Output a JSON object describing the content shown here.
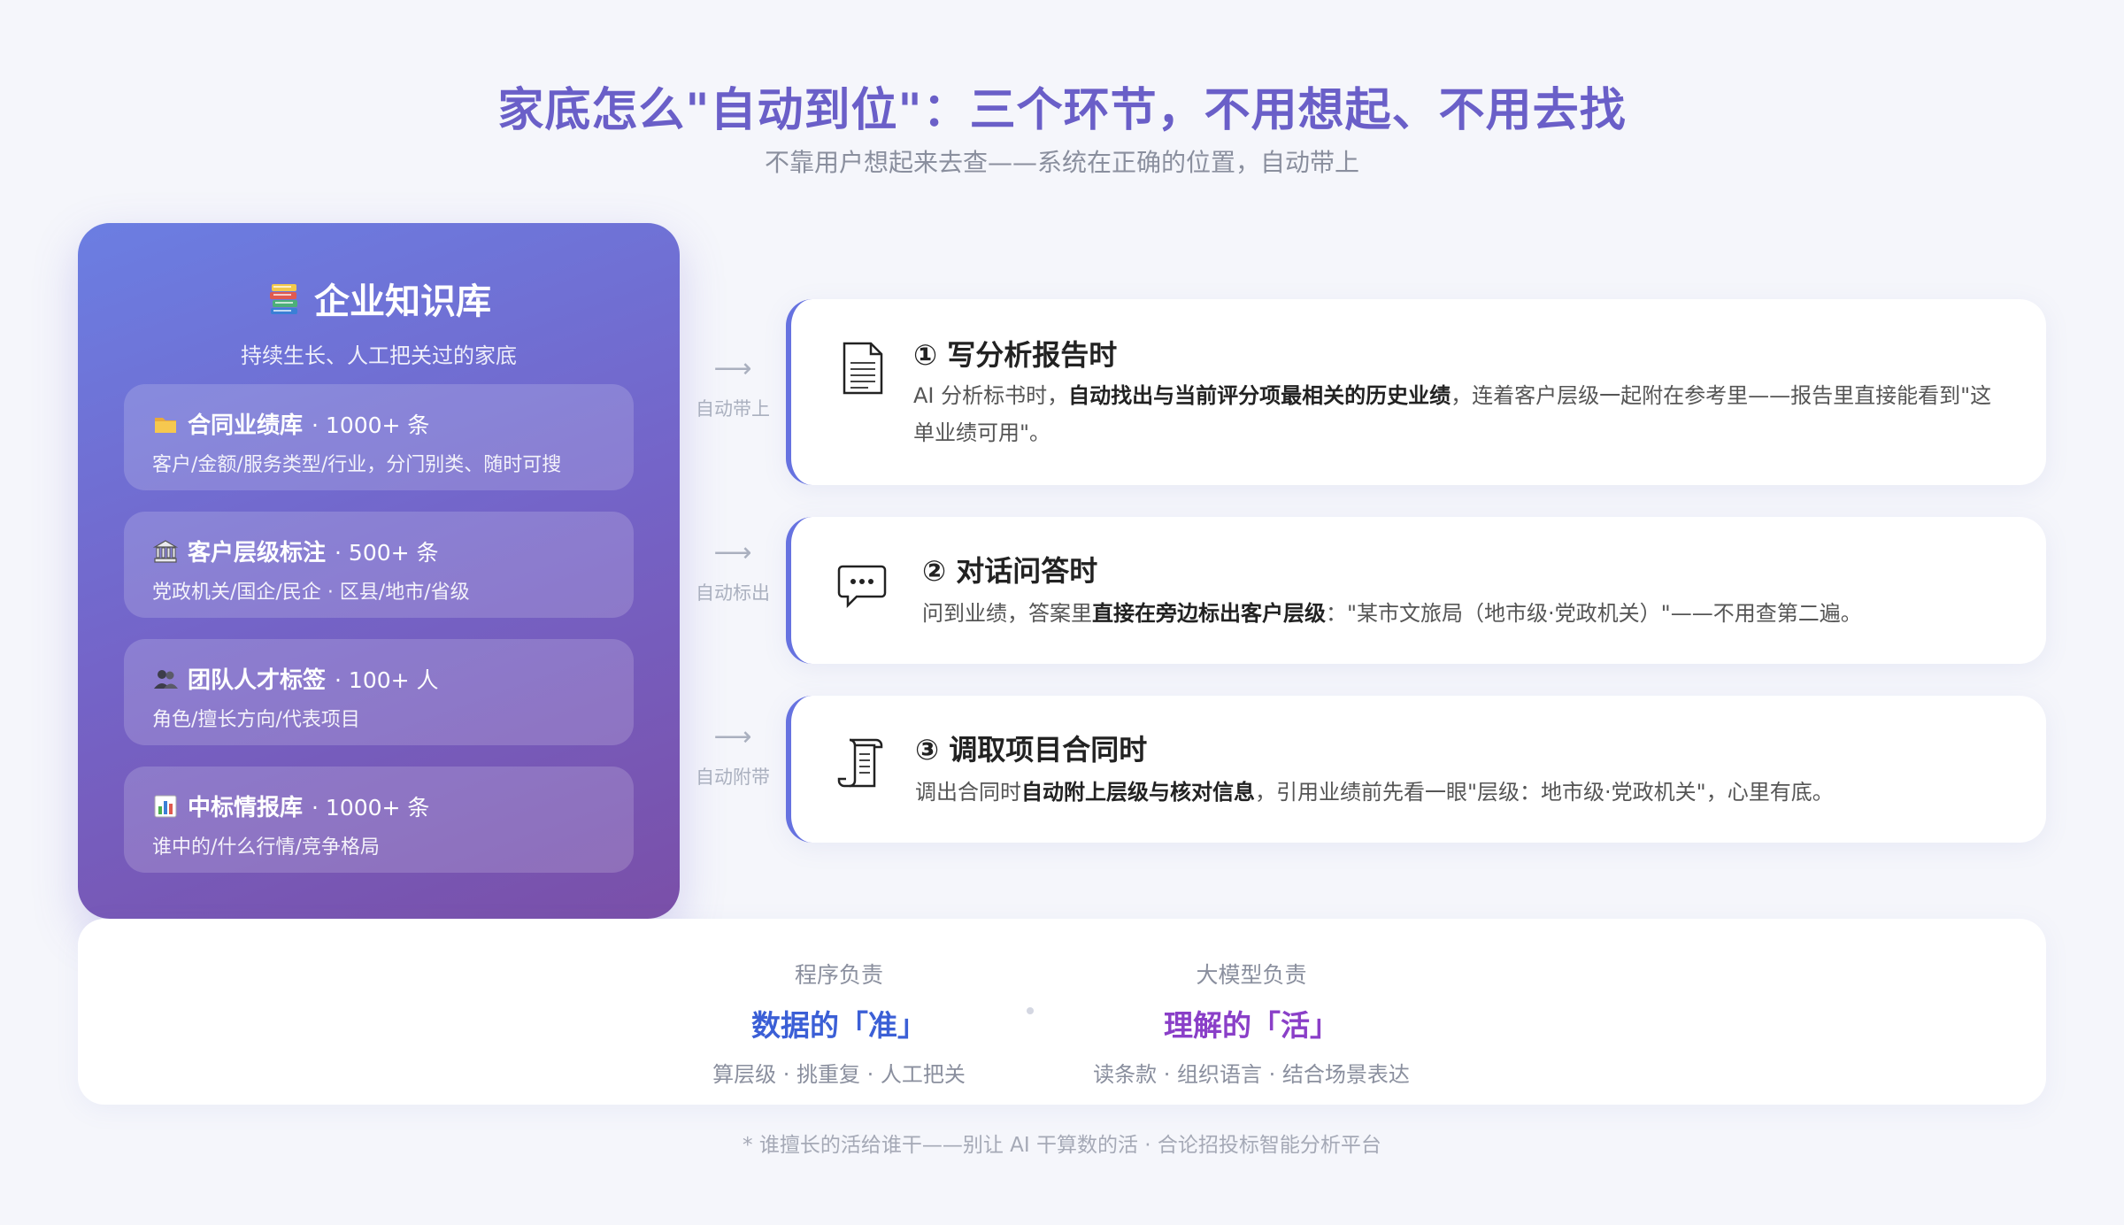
{
  "header": {
    "title": "家底怎么\"自动到位\"：三个环节，不用想起、不用去找",
    "subtitle": "不靠用户想起来去查——系统在正确的位置，自动带上"
  },
  "knowledge_base": {
    "title": "企业知识库",
    "subtitle": "持续生长、人工把关过的家底",
    "items": [
      {
        "icon": "folder-icon",
        "name": "合同业绩库",
        "count": "· 1000+ 条",
        "desc": "客户/金额/服务类型/行业，分门别类、随时可搜"
      },
      {
        "icon": "bank-icon",
        "name": "客户层级标注",
        "count": "· 500+ 条",
        "desc": "党政机关/国企/民企 · 区县/地市/省级"
      },
      {
        "icon": "people-icon",
        "name": "团队人才标签",
        "count": "· 100+ 人",
        "desc": "角色/擅长方向/代表项目"
      },
      {
        "icon": "bar-chart-icon",
        "name": "中标情报库",
        "count": "· 1000+ 条",
        "desc": "谁中的/什么行情/竞争格局"
      }
    ]
  },
  "connectors": [
    {
      "arrow": "⟶",
      "label": "自动带上"
    },
    {
      "arrow": "⟶",
      "label": "自动标出"
    },
    {
      "arrow": "⟶",
      "label": "自动附带"
    }
  ],
  "steps": [
    {
      "icon": "document-icon",
      "title": "① 写分析报告时",
      "desc_pre": "AI 分析标书时，",
      "desc_bold": "自动找出与当前评分项最相关的历史业绩",
      "desc_post": "，连着客户层级一起附在参考里——报告里直接能看到\"这单业绩可用\"。"
    },
    {
      "icon": "chat-bubble-icon",
      "title": "② 对话问答时",
      "desc_pre": "问到业绩，答案里",
      "desc_bold": "直接在旁边标出客户层级",
      "desc_post": "：\"某市文旅局（地市级·党政机关）\"——不用查第二遍。"
    },
    {
      "icon": "scroll-icon",
      "title": "③ 调取项目合同时",
      "desc_pre": "调出合同时",
      "desc_bold": "自动附上层级与核对信息",
      "desc_post": "，引用业绩前先看一眼\"层级：地市级·党政机关\"，心里有底。"
    }
  ],
  "division": {
    "program": {
      "key": "程序负责",
      "value": "数据的「准」",
      "desc": "算层级 · 挑重复 · 人工把关",
      "color": "#3b5fd6"
    },
    "model": {
      "key": "大模型负责",
      "value": "理解的「活」",
      "desc": "读条款 · 组织语言 · 结合场景表达",
      "color": "#8a3fc8"
    }
  },
  "footnote": "* 谁擅长的活给谁干——别让 AI 干算数的活 · 合论招投标智能分析平台"
}
